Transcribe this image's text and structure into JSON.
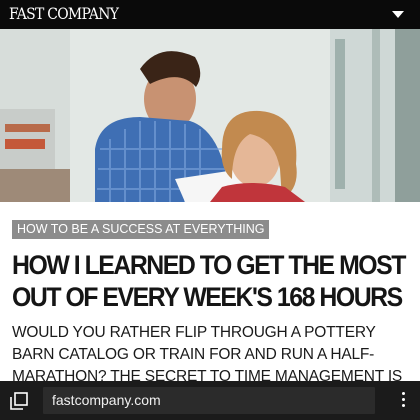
{
  "header": {
    "logo_text": "FAST COMPANY",
    "menu_icon": "caret-down-icon"
  },
  "article": {
    "hero_alt_icon": "photo-image",
    "section": "How to Be  a Success at Everything",
    "headline": "How I Learned To Get The Most Out Of Every Week's 168 Hours",
    "dek": "Would you rather flip through a Pottery Barn catalog or train for and run a half-marathon? The secret to time management is all about priorities."
  },
  "browser": {
    "tabs_icon": "tabs-icon",
    "url": "fastcompany.com",
    "overflow_icon": "more-vertical-icon"
  },
  "colors": {
    "topbar": "#0a0a0a",
    "section_label_bg": "#8c8c8c",
    "browserbar": "#1b1b1b"
  }
}
